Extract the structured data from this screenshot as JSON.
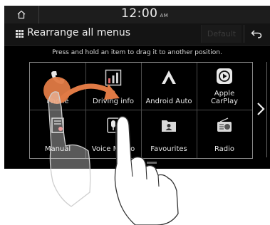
{
  "status": {
    "time": "12:00",
    "ampm": "AM"
  },
  "header": {
    "title": "Rearrange all menus",
    "default_label": "Default"
  },
  "instruction": "Press and hold an item to drag it to another position.",
  "menu_items": [
    {
      "label": "Phone",
      "icon": "phone-icon"
    },
    {
      "label": "Driving info",
      "icon": "driving-info-icon"
    },
    {
      "label": "Android Auto",
      "icon": "android-auto-icon"
    },
    {
      "label": "Apple CarPlay",
      "label_line1": "Apple",
      "label_line2": "CarPlay",
      "icon": "carplay-icon"
    },
    {
      "label": "Manual",
      "icon": "manual-icon"
    },
    {
      "label": "Voice Memo",
      "icon": "voice-memo-icon"
    },
    {
      "label": "Favourites",
      "icon": "favourites-icon"
    },
    {
      "label": "Radio",
      "icon": "radio-icon"
    }
  ],
  "colors": {
    "drag_highlight": "#e07a45",
    "background": "#000000",
    "text": "#e6e6e6"
  }
}
